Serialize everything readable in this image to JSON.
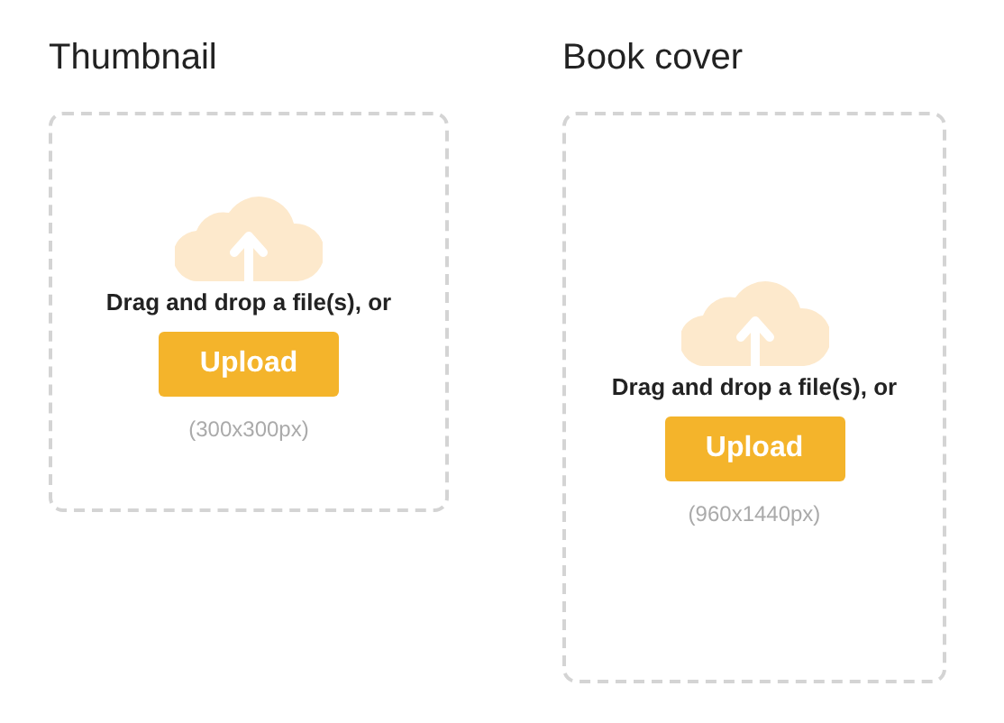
{
  "uploaders": [
    {
      "kind": "square",
      "title": "Thumbnail",
      "prompt": "Drag and drop a file(s), or",
      "button": "Upload",
      "size_hint": "(300x300px)"
    },
    {
      "kind": "tall",
      "title": "Book cover",
      "prompt": "Drag and drop a file(s), or",
      "button": "Upload",
      "size_hint": "(960x1440px)"
    }
  ]
}
